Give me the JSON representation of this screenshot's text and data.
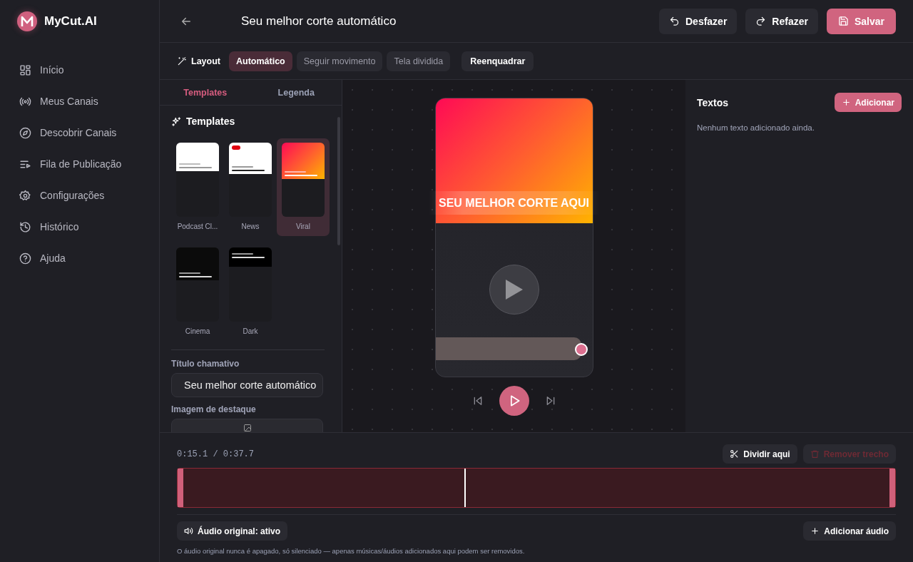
{
  "brand": {
    "name": "MyCut.AI"
  },
  "sidebar": {
    "items": [
      {
        "label": "Início",
        "kind": "grid",
        "selected": false
      },
      {
        "label": "Meus Canais",
        "kind": "broadcast",
        "selected": false
      },
      {
        "label": "Descobrir Canais",
        "kind": "compass",
        "selected": false
      },
      {
        "label": "Fila de Publicação",
        "kind": "queue",
        "selected": false
      },
      {
        "label": "Configurações",
        "kind": "gear",
        "selected": false
      },
      {
        "label": "Histórico",
        "kind": "history",
        "selected": false
      },
      {
        "label": "Ajuda",
        "kind": "help",
        "selected": false
      }
    ]
  },
  "header": {
    "title": "Seu melhor corte automático",
    "undo": "Desfazer",
    "redo": "Refazer",
    "save": "Salvar"
  },
  "toolbar": {
    "label": "Layout",
    "options": [
      {
        "label": "Automático",
        "selected": true
      },
      {
        "label": "Seguir movimento",
        "selected": false
      },
      {
        "label": "Tela dividida",
        "selected": false
      }
    ],
    "reframe": "Reenquadrar"
  },
  "left_panel": {
    "tabs": [
      {
        "label": "Templates",
        "selected": true
      },
      {
        "label": "Legenda",
        "selected": false
      }
    ],
    "section_title": "Templates",
    "templates": [
      {
        "name": "Podcast Cl...",
        "kind": "light",
        "selected": false
      },
      {
        "name": "News",
        "kind": "news",
        "selected": false
      },
      {
        "name": "Viral",
        "kind": "viral",
        "selected": true
      },
      {
        "name": "Cinema",
        "kind": "cinema",
        "selected": false
      },
      {
        "name": "Dark",
        "kind": "dark",
        "selected": false
      }
    ],
    "title_field": {
      "label": "Título chamativo",
      "value": "Seu melhor corte automático"
    },
    "image_field": {
      "label": "Imagem de destaque"
    }
  },
  "preview": {
    "overlay_title": "SEU MELHOR CORTE AQUI",
    "progress": {
      "level": 0.93
    }
  },
  "right_panel": {
    "title": "Textos",
    "add": "Adicionar",
    "empty": "Nenhum texto adicionado ainda."
  },
  "timeline": {
    "time": "0:15.1 / 0:37.7",
    "split": "Dividir aqui",
    "remove": {
      "label": "Remover trecho",
      "disabled": true
    },
    "playhead": {
      "level": 0.4
    },
    "audio_toggle": "Áudio original: ativo",
    "add_audio": "Adicionar áudio",
    "note": "O áudio original nunca é apagado, só silenciado — apenas músicas/áudios adicionados aqui podem ser removidos."
  }
}
